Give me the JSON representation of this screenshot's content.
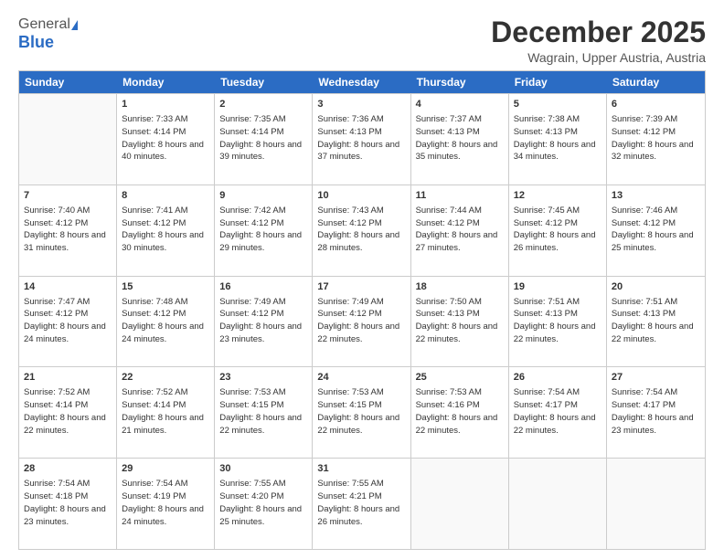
{
  "logo": {
    "general": "General",
    "blue": "Blue"
  },
  "header": {
    "title": "December 2025",
    "subtitle": "Wagrain, Upper Austria, Austria"
  },
  "weekdays": [
    "Sunday",
    "Monday",
    "Tuesday",
    "Wednesday",
    "Thursday",
    "Friday",
    "Saturday"
  ],
  "rows": [
    [
      {
        "day": "",
        "empty": true
      },
      {
        "day": "1",
        "sunrise": "Sunrise: 7:33 AM",
        "sunset": "Sunset: 4:14 PM",
        "daylight": "Daylight: 8 hours and 40 minutes."
      },
      {
        "day": "2",
        "sunrise": "Sunrise: 7:35 AM",
        "sunset": "Sunset: 4:14 PM",
        "daylight": "Daylight: 8 hours and 39 minutes."
      },
      {
        "day": "3",
        "sunrise": "Sunrise: 7:36 AM",
        "sunset": "Sunset: 4:13 PM",
        "daylight": "Daylight: 8 hours and 37 minutes."
      },
      {
        "day": "4",
        "sunrise": "Sunrise: 7:37 AM",
        "sunset": "Sunset: 4:13 PM",
        "daylight": "Daylight: 8 hours and 35 minutes."
      },
      {
        "day": "5",
        "sunrise": "Sunrise: 7:38 AM",
        "sunset": "Sunset: 4:13 PM",
        "daylight": "Daylight: 8 hours and 34 minutes."
      },
      {
        "day": "6",
        "sunrise": "Sunrise: 7:39 AM",
        "sunset": "Sunset: 4:12 PM",
        "daylight": "Daylight: 8 hours and 32 minutes."
      }
    ],
    [
      {
        "day": "7",
        "sunrise": "Sunrise: 7:40 AM",
        "sunset": "Sunset: 4:12 PM",
        "daylight": "Daylight: 8 hours and 31 minutes."
      },
      {
        "day": "8",
        "sunrise": "Sunrise: 7:41 AM",
        "sunset": "Sunset: 4:12 PM",
        "daylight": "Daylight: 8 hours and 30 minutes."
      },
      {
        "day": "9",
        "sunrise": "Sunrise: 7:42 AM",
        "sunset": "Sunset: 4:12 PM",
        "daylight": "Daylight: 8 hours and 29 minutes."
      },
      {
        "day": "10",
        "sunrise": "Sunrise: 7:43 AM",
        "sunset": "Sunset: 4:12 PM",
        "daylight": "Daylight: 8 hours and 28 minutes."
      },
      {
        "day": "11",
        "sunrise": "Sunrise: 7:44 AM",
        "sunset": "Sunset: 4:12 PM",
        "daylight": "Daylight: 8 hours and 27 minutes."
      },
      {
        "day": "12",
        "sunrise": "Sunrise: 7:45 AM",
        "sunset": "Sunset: 4:12 PM",
        "daylight": "Daylight: 8 hours and 26 minutes."
      },
      {
        "day": "13",
        "sunrise": "Sunrise: 7:46 AM",
        "sunset": "Sunset: 4:12 PM",
        "daylight": "Daylight: 8 hours and 25 minutes."
      }
    ],
    [
      {
        "day": "14",
        "sunrise": "Sunrise: 7:47 AM",
        "sunset": "Sunset: 4:12 PM",
        "daylight": "Daylight: 8 hours and 24 minutes."
      },
      {
        "day": "15",
        "sunrise": "Sunrise: 7:48 AM",
        "sunset": "Sunset: 4:12 PM",
        "daylight": "Daylight: 8 hours and 24 minutes."
      },
      {
        "day": "16",
        "sunrise": "Sunrise: 7:49 AM",
        "sunset": "Sunset: 4:12 PM",
        "daylight": "Daylight: 8 hours and 23 minutes."
      },
      {
        "day": "17",
        "sunrise": "Sunrise: 7:49 AM",
        "sunset": "Sunset: 4:12 PM",
        "daylight": "Daylight: 8 hours and 22 minutes."
      },
      {
        "day": "18",
        "sunrise": "Sunrise: 7:50 AM",
        "sunset": "Sunset: 4:13 PM",
        "daylight": "Daylight: 8 hours and 22 minutes."
      },
      {
        "day": "19",
        "sunrise": "Sunrise: 7:51 AM",
        "sunset": "Sunset: 4:13 PM",
        "daylight": "Daylight: 8 hours and 22 minutes."
      },
      {
        "day": "20",
        "sunrise": "Sunrise: 7:51 AM",
        "sunset": "Sunset: 4:13 PM",
        "daylight": "Daylight: 8 hours and 22 minutes."
      }
    ],
    [
      {
        "day": "21",
        "sunrise": "Sunrise: 7:52 AM",
        "sunset": "Sunset: 4:14 PM",
        "daylight": "Daylight: 8 hours and 22 minutes."
      },
      {
        "day": "22",
        "sunrise": "Sunrise: 7:52 AM",
        "sunset": "Sunset: 4:14 PM",
        "daylight": "Daylight: 8 hours and 21 minutes."
      },
      {
        "day": "23",
        "sunrise": "Sunrise: 7:53 AM",
        "sunset": "Sunset: 4:15 PM",
        "daylight": "Daylight: 8 hours and 22 minutes."
      },
      {
        "day": "24",
        "sunrise": "Sunrise: 7:53 AM",
        "sunset": "Sunset: 4:15 PM",
        "daylight": "Daylight: 8 hours and 22 minutes."
      },
      {
        "day": "25",
        "sunrise": "Sunrise: 7:53 AM",
        "sunset": "Sunset: 4:16 PM",
        "daylight": "Daylight: 8 hours and 22 minutes."
      },
      {
        "day": "26",
        "sunrise": "Sunrise: 7:54 AM",
        "sunset": "Sunset: 4:17 PM",
        "daylight": "Daylight: 8 hours and 22 minutes."
      },
      {
        "day": "27",
        "sunrise": "Sunrise: 7:54 AM",
        "sunset": "Sunset: 4:17 PM",
        "daylight": "Daylight: 8 hours and 23 minutes."
      }
    ],
    [
      {
        "day": "28",
        "sunrise": "Sunrise: 7:54 AM",
        "sunset": "Sunset: 4:18 PM",
        "daylight": "Daylight: 8 hours and 23 minutes."
      },
      {
        "day": "29",
        "sunrise": "Sunrise: 7:54 AM",
        "sunset": "Sunset: 4:19 PM",
        "daylight": "Daylight: 8 hours and 24 minutes."
      },
      {
        "day": "30",
        "sunrise": "Sunrise: 7:55 AM",
        "sunset": "Sunset: 4:20 PM",
        "daylight": "Daylight: 8 hours and 25 minutes."
      },
      {
        "day": "31",
        "sunrise": "Sunrise: 7:55 AM",
        "sunset": "Sunset: 4:21 PM",
        "daylight": "Daylight: 8 hours and 26 minutes."
      },
      {
        "day": "",
        "empty": true
      },
      {
        "day": "",
        "empty": true
      },
      {
        "day": "",
        "empty": true
      }
    ]
  ]
}
